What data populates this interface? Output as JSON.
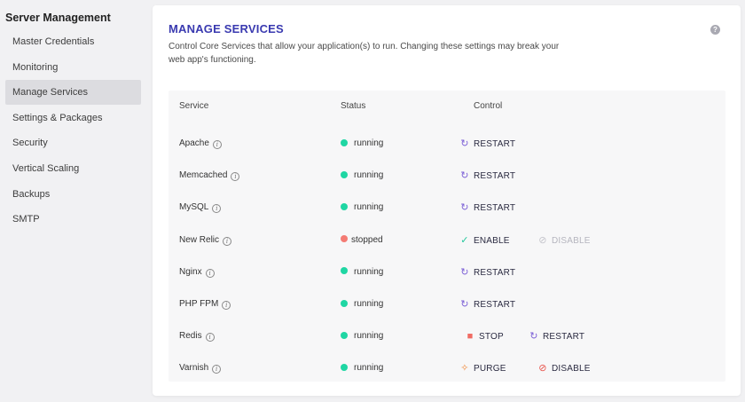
{
  "sidebar": {
    "title": "Server Management",
    "items": [
      {
        "label": "Master Credentials"
      },
      {
        "label": "Monitoring"
      },
      {
        "label": "Manage Services"
      },
      {
        "label": "Settings & Packages"
      },
      {
        "label": "Security"
      },
      {
        "label": "Vertical Scaling"
      },
      {
        "label": "Backups"
      },
      {
        "label": "SMTP"
      }
    ],
    "active_index": 2
  },
  "page": {
    "title": "MANAGE SERVICES",
    "description": "Control Core Services that allow your application(s) to run. Changing these settings may break your web app's functioning.",
    "help_glyph": "?"
  },
  "table": {
    "headers": {
      "service": "Service",
      "status": "Status",
      "control": "Control"
    },
    "info_glyph": "i",
    "rows": [
      {
        "service": "Apache",
        "status": "running",
        "controls": [
          {
            "label": "RESTART",
            "icon": "restart-icon"
          }
        ]
      },
      {
        "service": "Memcached",
        "status": "running",
        "controls": [
          {
            "label": "RESTART",
            "icon": "restart-icon"
          }
        ]
      },
      {
        "service": "MySQL",
        "status": "running",
        "controls": [
          {
            "label": "RESTART",
            "icon": "restart-icon"
          }
        ]
      },
      {
        "service": "New Relic",
        "status": "stopped",
        "controls": [
          {
            "label": "ENABLE",
            "icon": "check-circle-icon"
          },
          {
            "label": "DISABLE",
            "icon": "ban-icon",
            "disabled": true
          }
        ]
      },
      {
        "service": "Nginx",
        "status": "running",
        "controls": [
          {
            "label": "RESTART",
            "icon": "restart-icon"
          }
        ]
      },
      {
        "service": "PHP FPM",
        "status": "running",
        "controls": [
          {
            "label": "RESTART",
            "icon": "restart-icon"
          }
        ]
      },
      {
        "service": "Redis",
        "status": "running",
        "controls": [
          {
            "label": "STOP",
            "icon": "stop-icon"
          },
          {
            "label": "RESTART",
            "icon": "restart-icon"
          }
        ]
      },
      {
        "service": "Varnish",
        "status": "running",
        "controls": [
          {
            "label": "PURGE",
            "icon": "broom-icon"
          },
          {
            "label": "DISABLE",
            "icon": "ban-icon"
          }
        ]
      }
    ]
  },
  "colors": {
    "accent": "#3a3ab0",
    "running": "#1fd6a3",
    "stopped": "#f47b74",
    "restart_icon": "#7b5fd6",
    "enable_icon": "#22c79b",
    "stop_icon": "#f06b63",
    "purge_icon": "#f08a3c",
    "disable_icon": "#e8554d"
  }
}
